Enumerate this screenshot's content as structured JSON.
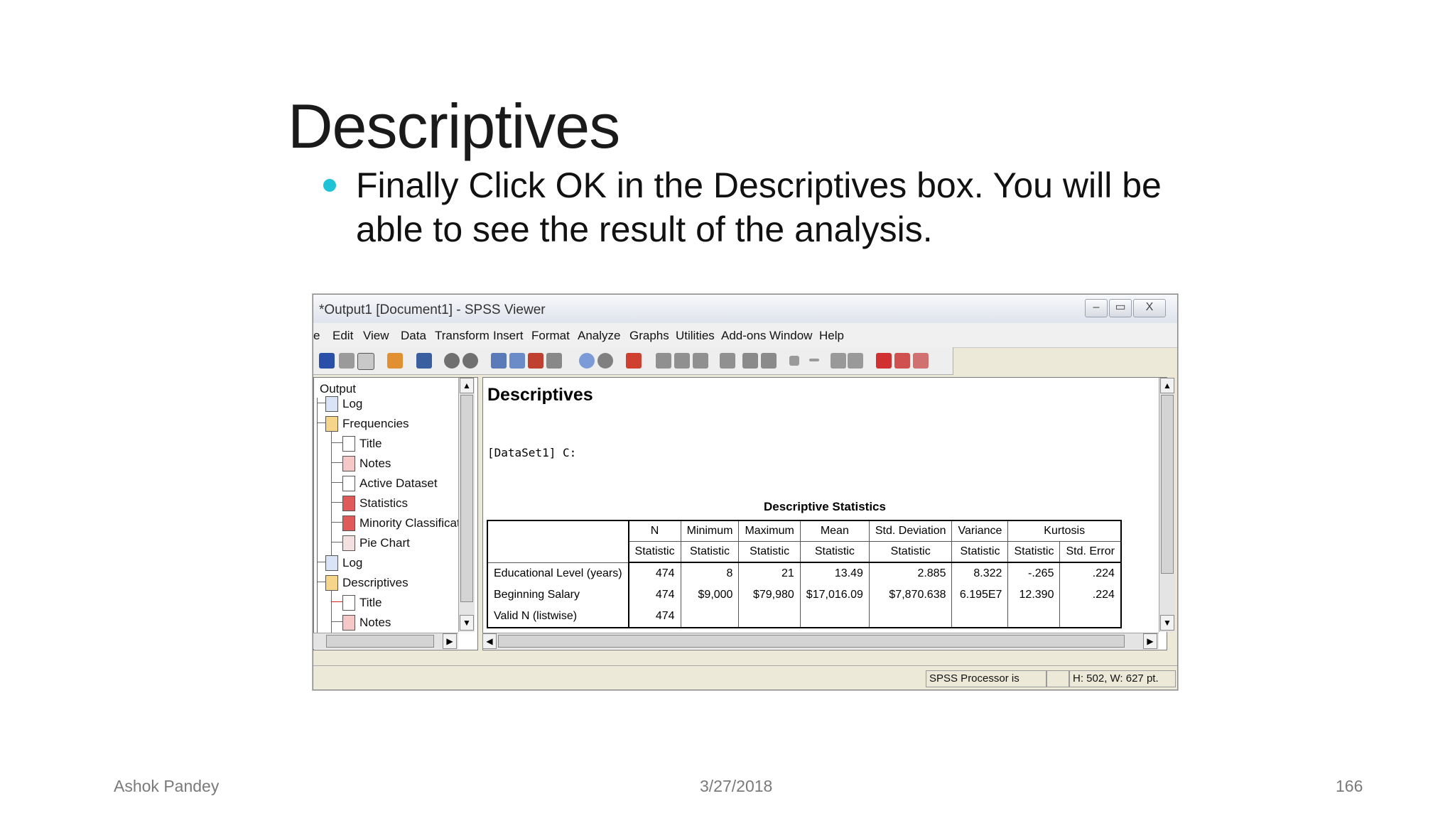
{
  "slide": {
    "title": "Descriptives",
    "bullet": "Finally Click OK in the Descriptives box. You will be able to see the result of the analysis.",
    "bullet_color": "#1fc3d6"
  },
  "footer": {
    "author": "Ashok Pandey",
    "date": "3/27/2018",
    "page": "166"
  },
  "window": {
    "title": "*Output1 [Document1] - SPSS Viewer",
    "controls": {
      "minimize": "–",
      "restore": "▭",
      "close": "X"
    }
  },
  "menu": [
    "e",
    "Edit",
    "View",
    "Data",
    "Transform",
    "Insert",
    "Format",
    "Analyze",
    "Graphs",
    "Utilities",
    "Add-ons",
    "Window",
    "Help"
  ],
  "tree": {
    "root": "Output",
    "items": [
      "Log",
      "Frequencies",
      "Title",
      "Notes",
      "Active Dataset",
      "Statistics",
      "Minority Classificati",
      "Pie Chart",
      "Log",
      "Descriptives",
      "Title",
      "Notes"
    ]
  },
  "content": {
    "heading": "Descriptives",
    "dataset_line": "[DataSet1] C:",
    "table": {
      "caption": "Descriptive Statistics",
      "col_groups": [
        "N",
        "Minimum",
        "Maximum",
        "Mean",
        "Std. Deviation",
        "Variance",
        "Kurtosis"
      ],
      "sub_headers": [
        "Statistic",
        "Statistic",
        "Statistic",
        "Statistic",
        "Statistic",
        "Statistic",
        "Statistic",
        "Std. Error"
      ],
      "rows": [
        {
          "label": "Educational Level (years)",
          "cells": [
            "474",
            "8",
            "21",
            "13.49",
            "2.885",
            "8.322",
            "-.265",
            ".224"
          ]
        },
        {
          "label": "Beginning Salary",
          "cells": [
            "474",
            "$9,000",
            "$79,980",
            "$17,016.09",
            "$7,870.638",
            "6.195E7",
            "12.390",
            ".224"
          ]
        },
        {
          "label": "Valid N (listwise)",
          "cells": [
            "474",
            "",
            "",
            "",
            "",
            "",
            "",
            ""
          ]
        }
      ]
    }
  },
  "status": {
    "processor": "SPSS  Processor is ready",
    "size": "H: 502, W: 627 pt."
  }
}
